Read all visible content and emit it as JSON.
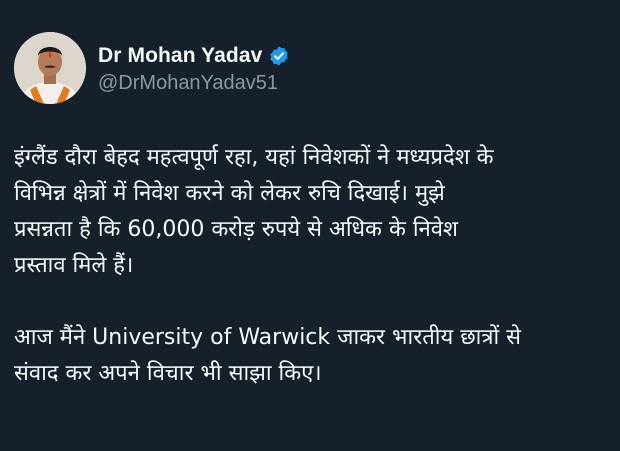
{
  "tweet": {
    "author": {
      "display_name": "Dr Mohan Yadav",
      "handle": "@DrMohanYadav51",
      "verified_icon": "verified-badge-icon",
      "avatar_icon": "profile-photo"
    },
    "paragraphs": [
      {
        "lines": [
          "इंग्लैंड दौरा बेहद महत्वपूर्ण रहा, यहां निवेशकों ने मध्यप्रदेश के",
          "विभिन्न क्षेत्रों में निवेश करने को लेकर रुचि दिखाई। मुझे",
          "प्रसन्नता है कि 60,000 करोड़ रुपये से अधिक के निवेश",
          "प्रस्ताव मिले हैं।"
        ]
      },
      {
        "lines": [
          "आज मैंने University of Warwick जाकर भारतीय छात्रों से",
          "संवाद कर अपने विचार भी साझा किए।"
        ]
      }
    ]
  },
  "colors": {
    "background": "#15202b",
    "text": "#f7f9f9",
    "muted": "#8b98a5",
    "accent": "#1d9bf0"
  }
}
